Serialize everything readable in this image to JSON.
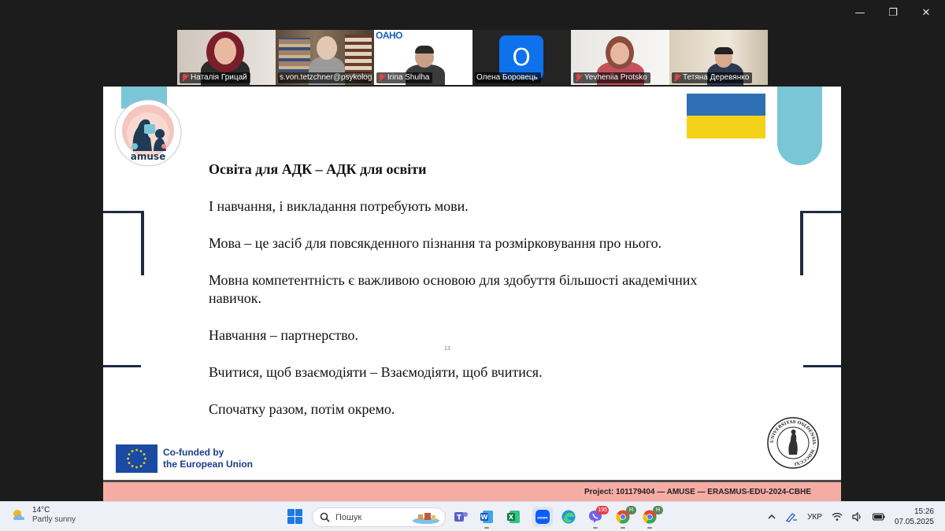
{
  "window": {
    "minimize": "—",
    "restore": "❐",
    "close": "✕"
  },
  "participants": [
    {
      "name": "Наталія Грицай",
      "muted": true
    },
    {
      "name": "s.von.tetzchner@psykolog...",
      "muted": false,
      "active": true
    },
    {
      "name": "Irina Shulha",
      "muted": true,
      "logo": "OAHO"
    },
    {
      "name": "Олена Боровець",
      "muted": false,
      "initial": "O"
    },
    {
      "name": "Yevheniia Protsko",
      "muted": true
    },
    {
      "name": "Тетяна Деревянко",
      "muted": true
    }
  ],
  "slide": {
    "logo_text": "amuse",
    "title": "Освіта для АДК – АДК для освіти",
    "paragraphs": [
      "І навчання, і викладання потребують мови.",
      "Мова – це засіб для повсякденного пізнання та розмірковування про нього.",
      "Мовна компетентність є важливою основою для здобуття більшості академічних навичок.",
      "Навчання – партнерство.",
      "Вчитися, щоб взаємодіяти – Взаємодіяти, щоб вчитися.",
      "Спочатку разом, потім окремо."
    ],
    "page_number": "13",
    "eu_line1": "Co-funded by",
    "eu_line2": "the European Union",
    "seal_text": "UNIVERSITAS OSLOENSIS · MDCCCXI",
    "footer": "Project: 101179404 — AMUSE — ERASMUS-EDU-2024-CBHE"
  },
  "taskbar": {
    "weather_temp": "14°C",
    "weather_desc": "Partly sunny",
    "search_placeholder": "Пошук",
    "apps": [
      {
        "name": "teams-icon",
        "color": "#5b5fc7"
      },
      {
        "name": "word-icon",
        "color": "#185abd"
      },
      {
        "name": "excel-icon",
        "color": "#107c41"
      },
      {
        "name": "zoom-icon",
        "color": "#0b5cff"
      },
      {
        "name": "edge-icon",
        "color": "#1a9ad7"
      },
      {
        "name": "viber-icon",
        "color": "#7360f2",
        "badge": "195"
      },
      {
        "name": "chrome-icon",
        "color": "#34a853",
        "badge": "H"
      },
      {
        "name": "chrome-icon-2",
        "color": "#34a853",
        "badge": "H"
      }
    ],
    "language": "УКР",
    "time": "15:26",
    "date": "07.05.2025"
  }
}
